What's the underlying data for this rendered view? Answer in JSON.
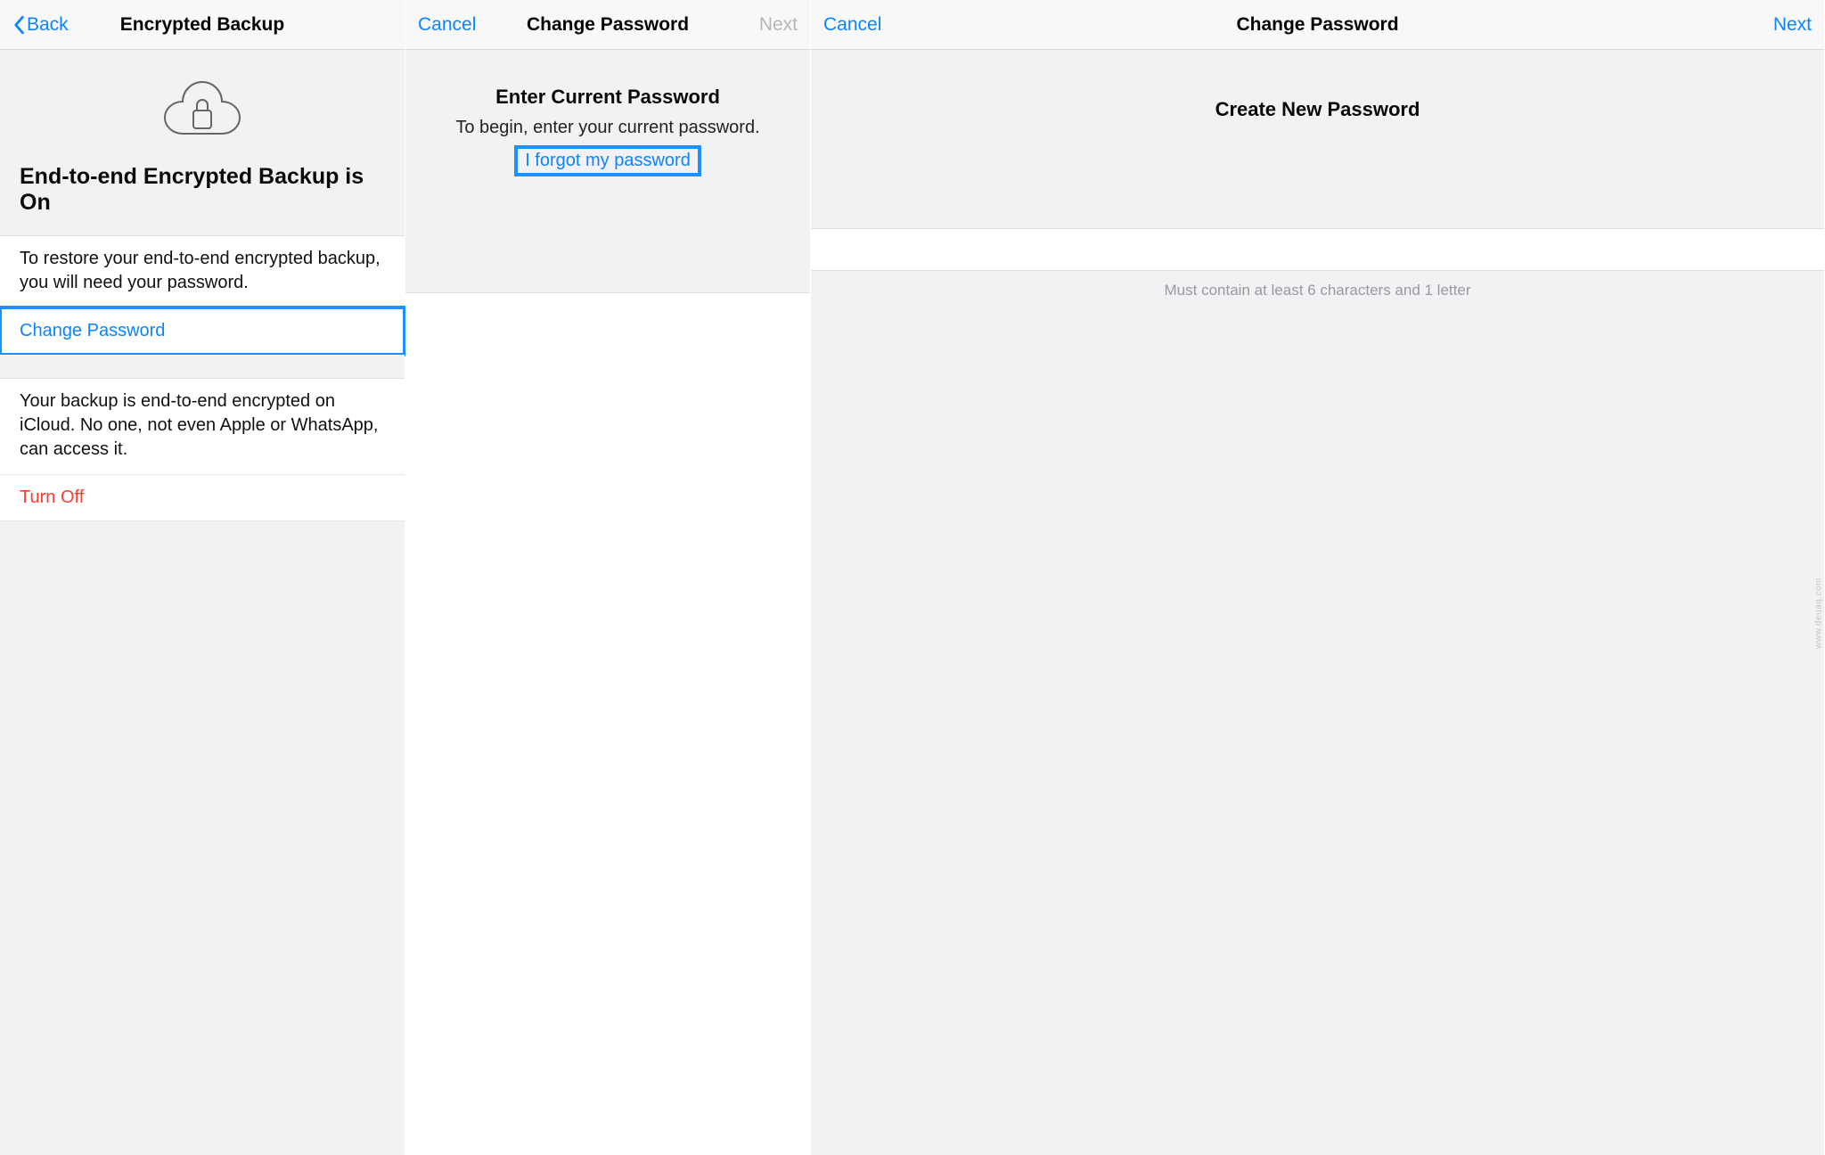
{
  "panel1": {
    "nav": {
      "back": "Back",
      "title": "Encrypted Backup"
    },
    "hero_heading": "End-to-end Encrypted Backup is On",
    "section1_desc": "To restore your end-to-end encrypted backup, you will need your password.",
    "change_password": "Change Password",
    "section2_desc": "Your backup is end-to-end encrypted on iCloud. No one, not even Apple or WhatsApp, can access it.",
    "turn_off": "Turn Off"
  },
  "panel2": {
    "nav": {
      "cancel": "Cancel",
      "title": "Change Password",
      "next": "Next"
    },
    "heading": "Enter Current Password",
    "subtext": "To begin, enter your current password.",
    "forgot": "I forgot my password"
  },
  "panel3": {
    "nav": {
      "cancel": "Cancel",
      "title": "Change Password",
      "next": "Next"
    },
    "heading": "Create New Password",
    "hint": "Must contain at least 6 characters and 1 letter"
  },
  "watermark": "www.deuaq.com"
}
